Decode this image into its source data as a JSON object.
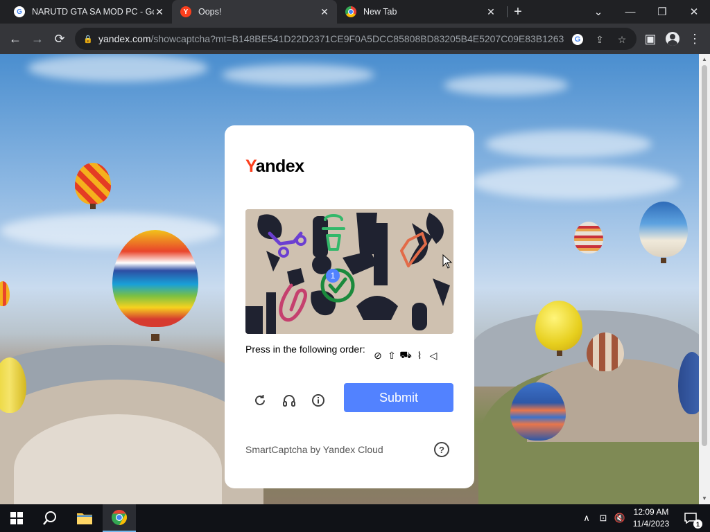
{
  "tabs": [
    {
      "title": "NARUTD GTA SA MOD PC - Goo",
      "favicon": "google-icon",
      "active": false
    },
    {
      "title": "Oops!",
      "favicon": "yandex-icon",
      "active": true
    },
    {
      "title": "New Tab",
      "favicon": "chrome-icon",
      "active": false
    }
  ],
  "tab_close_glyph": "✕",
  "new_tab_glyph": "+",
  "window_controls": {
    "tab_search": "⌄",
    "minimize": "—",
    "restore": "❐",
    "close": "✕"
  },
  "toolbar": {
    "back": "←",
    "forward": "→",
    "reload": "⟳",
    "url_host": "yandex.com",
    "url_path": "/showcaptcha?mt=B148BE541D22D2371CE9F0A5DCC85808BD83205B4E5207C09E83B1263FDA...",
    "google_lens": "G",
    "share": "⇪",
    "bookmark": "☆",
    "side_panel": "▣",
    "menu": "⋮"
  },
  "captcha": {
    "logo_first": "Y",
    "logo_rest": "andex",
    "instruction": "Press in the following order:",
    "order_icons": [
      "compass-icon",
      "up-arrow-icon",
      "stroller-icon",
      "paperclip-icon",
      "speaker-icon"
    ],
    "order_glyphs": [
      "⊘",
      "⇧",
      "⛟",
      "⌇",
      "◁"
    ],
    "marker_number": "1",
    "refresh_glyph": "↻",
    "audio_glyph": "♫",
    "info_glyph": "ⓘ",
    "submit_label": "Submit",
    "footer": "SmartCaptcha by Yandex Cloud",
    "help_glyph": "?"
  },
  "taskbar": {
    "time": "12:09 AM",
    "date": "11/4/2023",
    "chevron": "∧",
    "network": "⊡",
    "volume": "🔇",
    "notifications": "1"
  },
  "colors": {
    "brand_red": "#fc3f1d",
    "submit_blue": "#5282ff",
    "chrome_bg": "#202124",
    "chrome_toolbar": "#35363a"
  }
}
